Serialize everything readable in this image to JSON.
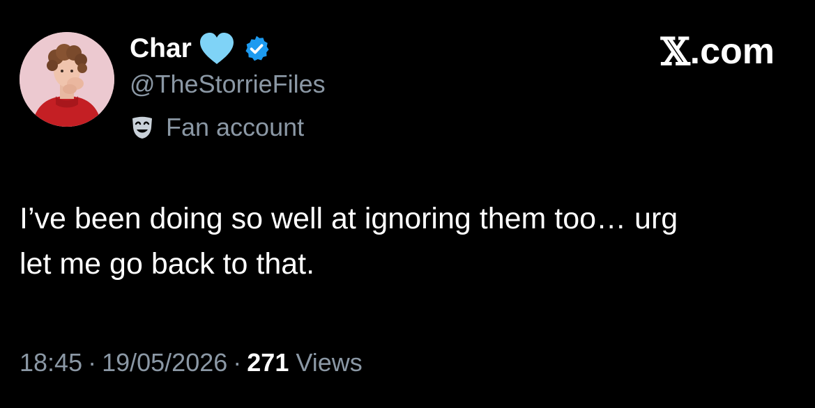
{
  "colors": {
    "background": "#000000",
    "primary_text": "#ffffff",
    "secondary_text": "#8b98a5",
    "verified_badge": "#1d9bf0",
    "heart": "#7fd3f7"
  },
  "author": {
    "display_name": "Char",
    "emoji_icon": "light-blue-heart-icon",
    "verified_icon": "verified-badge-icon",
    "handle": "@TheStorrieFiles",
    "affiliation_icon": "theater-mask-icon",
    "affiliation": "Fan account"
  },
  "brand": {
    "x_glyph": "𝕏",
    "domain": ".com"
  },
  "tweet": {
    "lines": [
      "I’ve been doing so well at ignoring them too… urg",
      "let me go back to that."
    ]
  },
  "meta": {
    "time": "18:45",
    "separator": "·",
    "date": "19/05/2026",
    "views_count": "271",
    "views_label": "Views"
  }
}
